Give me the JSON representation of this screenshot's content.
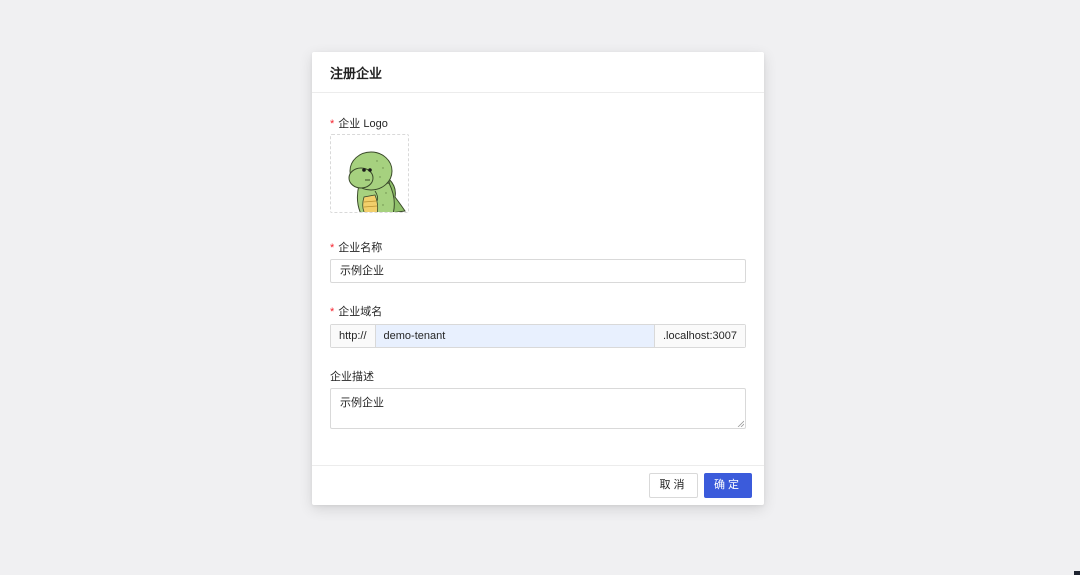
{
  "modal": {
    "title": "注册企业"
  },
  "form": {
    "logo": {
      "required": "*",
      "label": "企业 Logo"
    },
    "name": {
      "required": "*",
      "label": "企业名称",
      "value": "示例企业"
    },
    "domain": {
      "required": "*",
      "label": "企业域名",
      "prefix": "http://",
      "value": "demo-tenant",
      "suffix": ".localhost:3007"
    },
    "description": {
      "label": "企业描述",
      "value": "示例企业"
    }
  },
  "footer": {
    "cancel_label": "取消",
    "ok_label": "确定"
  },
  "colors": {
    "primary": "#3b5bdb",
    "required": "#f5222d",
    "autofill": "#e8f0fe"
  },
  "icons": {
    "logo_image": "dinosaur-mascot-icon"
  }
}
